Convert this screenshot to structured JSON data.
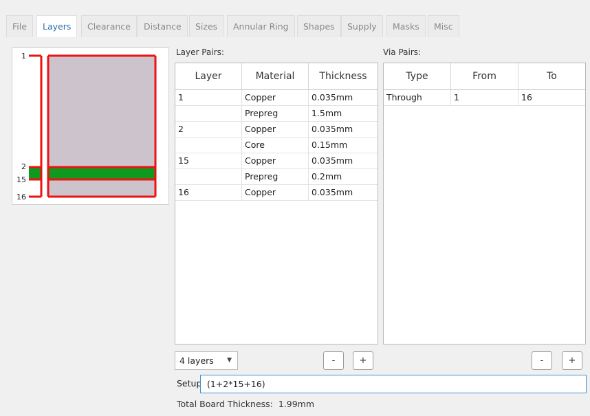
{
  "tabs": [
    {
      "label": "File",
      "active": false
    },
    {
      "label": "Layers",
      "active": true
    },
    {
      "label": "Clearance",
      "active": false
    },
    {
      "label": "Distance",
      "active": false
    },
    {
      "label": "Sizes",
      "active": false
    },
    {
      "label": "Annular Ring",
      "active": false
    },
    {
      "label": "Shapes",
      "active": false
    },
    {
      "label": "Supply",
      "active": false
    },
    {
      "label": "Masks",
      "active": false
    },
    {
      "label": "Misc",
      "active": false
    }
  ],
  "preview": {
    "layer_labels": [
      "1",
      "2",
      "15",
      "16"
    ],
    "colors": {
      "board": "#cdc3cc",
      "copper_outline": "#ee1111",
      "core_fill": "#0f9a1f"
    }
  },
  "layer_pairs": {
    "label": "Layer Pairs:",
    "columns": [
      "Layer",
      "Material",
      "Thickness"
    ],
    "rows": [
      [
        "1",
        "Copper",
        "0.035mm"
      ],
      [
        "",
        "Prepreg",
        "1.5mm"
      ],
      [
        "2",
        "Copper",
        "0.035mm"
      ],
      [
        "",
        "Core",
        "0.15mm"
      ],
      [
        "15",
        "Copper",
        "0.035mm"
      ],
      [
        "",
        "Prepreg",
        "0.2mm"
      ],
      [
        "16",
        "Copper",
        "0.035mm"
      ]
    ],
    "layers_select": "4 layers",
    "remove_label": "-",
    "add_label": "+"
  },
  "via_pairs": {
    "label": "Via Pairs:",
    "columns": [
      "Type",
      "From",
      "To"
    ],
    "rows": [
      [
        "Through",
        "1",
        "16"
      ]
    ],
    "remove_label": "-",
    "add_label": "+"
  },
  "setup": {
    "label": "Setup",
    "value": "(1+2*15+16)"
  },
  "total": {
    "label": "Total Board Thickness:",
    "value": "1.99mm"
  }
}
